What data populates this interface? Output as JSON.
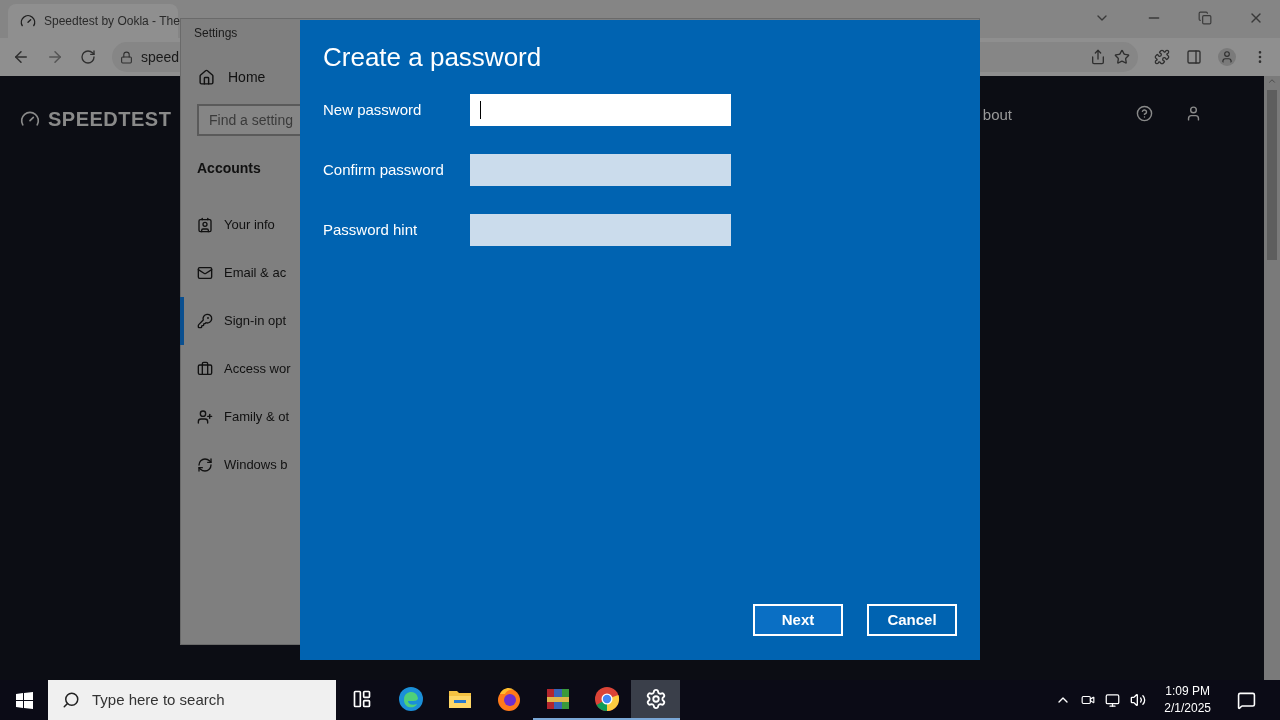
{
  "browser": {
    "tab_title": "Speedtest by Ookla - The",
    "url": "speed",
    "site": {
      "logo": "SPEEDTEST",
      "nav_link": "bout"
    }
  },
  "settings": {
    "title": "Settings",
    "home": "Home",
    "search": {
      "placeholder": "Find a setting"
    },
    "section": "Accounts",
    "items": [
      {
        "label": "Your info",
        "selected": false
      },
      {
        "label": "Email & ac",
        "selected": false
      },
      {
        "label": "Sign-in opt",
        "selected": true
      },
      {
        "label": "Access wor",
        "selected": false
      },
      {
        "label": "Family & ot",
        "selected": false
      },
      {
        "label": "Windows b",
        "selected": false
      }
    ]
  },
  "dialog": {
    "title": "Create a password",
    "fields": [
      {
        "label": "New password",
        "focused": true
      },
      {
        "label": "Confirm password",
        "focused": false
      },
      {
        "label": "Password hint",
        "focused": false
      }
    ],
    "buttons": [
      "Next",
      "Cancel"
    ]
  },
  "taskbar": {
    "search": {
      "placeholder": "Type here to search"
    },
    "apps": [
      {
        "running": false,
        "selected": false
      },
      {
        "running": false,
        "selected": false
      },
      {
        "running": false,
        "selected": false
      },
      {
        "running": false,
        "selected": false
      },
      {
        "running": true,
        "selected": false
      },
      {
        "running": true,
        "selected": false
      },
      {
        "running": true,
        "selected": true
      }
    ],
    "time": "1:09 PM",
    "date": "2/1/2025"
  }
}
